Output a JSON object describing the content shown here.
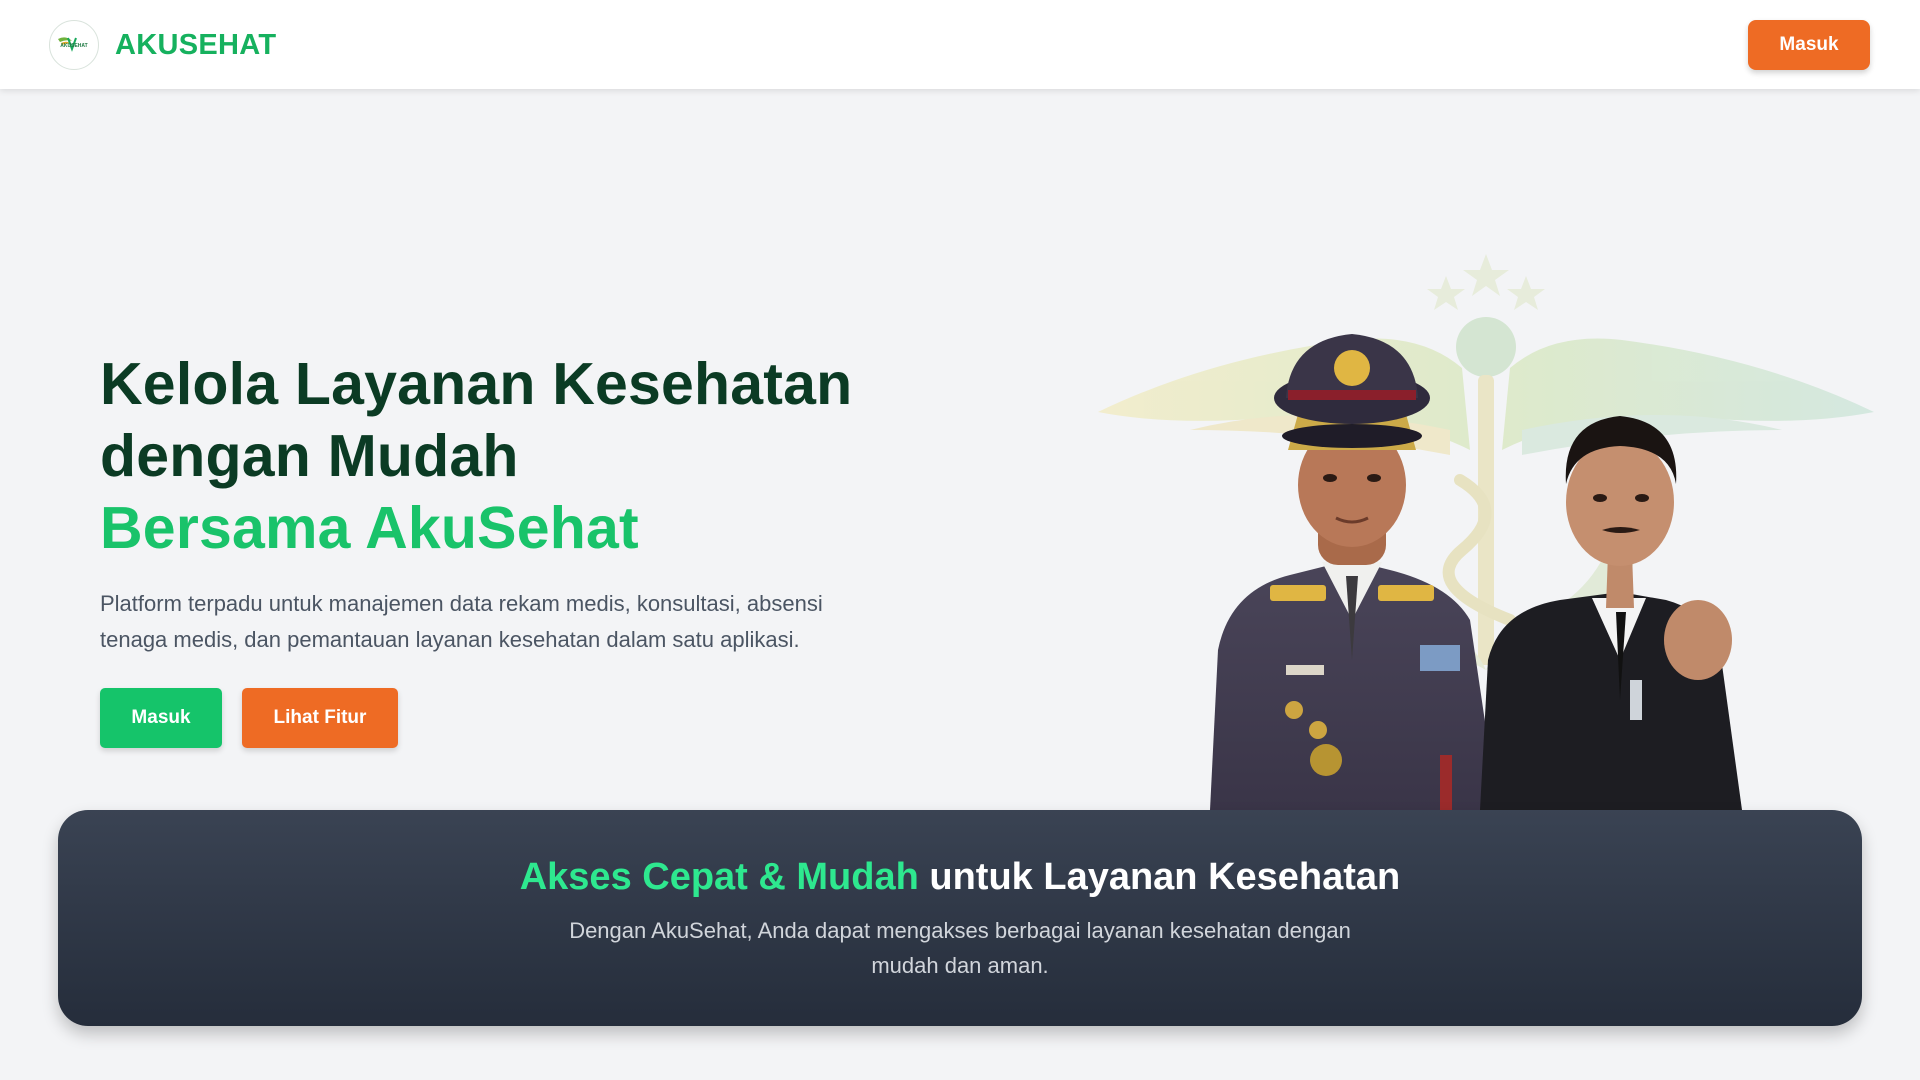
{
  "navbar": {
    "brand_name": "AKUSEHAT",
    "logo_text": "AKUSEHAT",
    "login_label": "Masuk"
  },
  "hero": {
    "title_line1": "Kelola Layanan Kesehatan",
    "title_line2": "dengan Mudah",
    "title_accent": "Bersama AkuSehat",
    "description": "Platform terpadu untuk manajemen data rekam medis, konsultasi, absensi tenaga medis, dan pemantauan layanan kesehatan dalam satu aplikasi.",
    "primary_button": "Masuk",
    "secondary_button": "Lihat Fitur",
    "illustration": {
      "emblem_icon": "winged-caduceus-emblem",
      "portrait_left_icon": "police-general-portrait",
      "portrait_right_icon": "suited-man-portrait"
    }
  },
  "banner": {
    "title_highlight": "Akses Cepat & Mudah",
    "title_rest": " untuk Layanan Kesehatan",
    "description": "Dengan AkuSehat, Anda dapat mengakses berbagai layanan kesehatan dengan mudah dan aman."
  },
  "colors": {
    "brand_green": "#16b15e",
    "accent_green": "#19c36a",
    "heading_dark": "#0b3b24",
    "cta_orange": "#ee6b24",
    "banner_bg": "#2f3746",
    "banner_highlight": "#2ee88f",
    "page_bg": "#f3f4f6"
  }
}
